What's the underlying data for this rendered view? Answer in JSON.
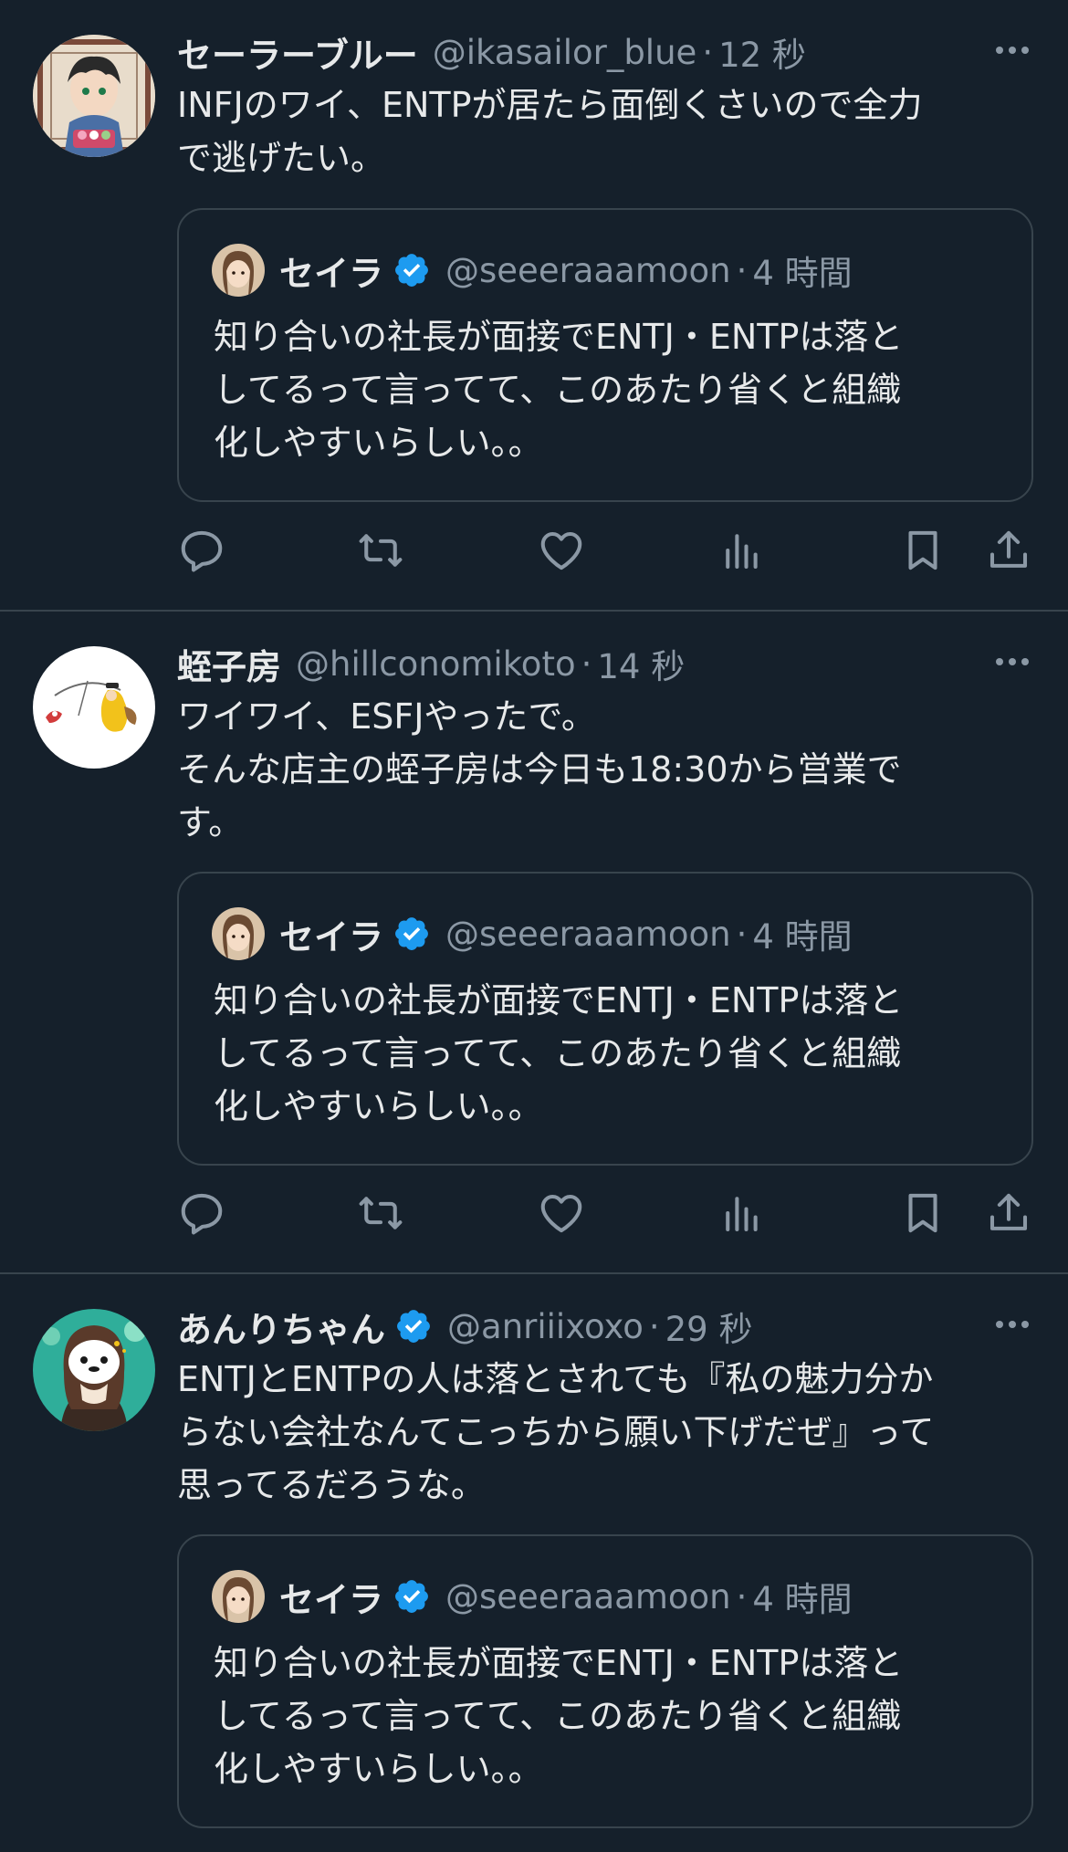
{
  "colors": {
    "background": "#15202b",
    "text": "#e7e9ea",
    "secondary": "#8b98a5",
    "divider": "#38444d",
    "verified": "#1d9bf0"
  },
  "tweets": [
    {
      "name": "セーラーブルー",
      "handle": "@ikasailor_blue",
      "sep": "·",
      "time": "12 秒",
      "verified": false,
      "text": "INFJのワイ、ENTPが居たら面倒くさいので全力\nで逃げたい。",
      "quote": {
        "name": "セイラ",
        "handle": "@seeeraaamoon",
        "sep": "·",
        "time": "4 時間",
        "text": "知り合いの社長が面接でENTJ・ENTPは落と\nしてるって言ってて、このあたり省くと組織\n化しやすいらしい。。"
      }
    },
    {
      "name": "蛭子房",
      "handle": "@hillconomikoto",
      "sep": "·",
      "time": "14 秒",
      "verified": false,
      "text": "ワイワイ、ESFJやったで。\nそんな店主の蛭子房は今日も18:30から営業で\nす。",
      "quote": {
        "name": "セイラ",
        "handle": "@seeeraaamoon",
        "sep": "·",
        "time": "4 時間",
        "text": "知り合いの社長が面接でENTJ・ENTPは落と\nしてるって言ってて、このあたり省くと組織\n化しやすいらしい。。"
      }
    },
    {
      "name": "あんりちゃん",
      "handle": "@anriiixoxo",
      "sep": "·",
      "time": "29 秒",
      "verified": true,
      "text": "ENTJとENTPの人は落とされても『私の魅力分か\nらない会社なんてこっちから願い下げだぜ』って\n思ってるだろうな。",
      "quote": {
        "name": "セイラ",
        "handle": "@seeeraaamoon",
        "sep": "·",
        "time": "4 時間",
        "text": "知り合いの社長が面接でENTJ・ENTPは落と\nしてるって言ってて、このあたり省くと組織\n化しやすいらしい。。"
      }
    }
  ],
  "icons": {
    "more": "more-icon",
    "reply": "reply-icon",
    "retweet": "retweet-icon",
    "like": "like-icon",
    "views": "views-icon",
    "bookmark": "bookmark-icon",
    "share": "share-icon",
    "verified": "verified-badge-icon"
  }
}
